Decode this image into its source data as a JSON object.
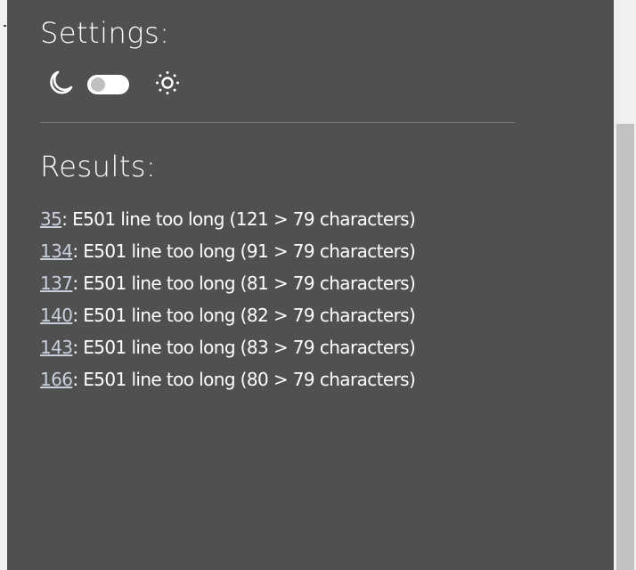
{
  "settings": {
    "title": "Settings:",
    "theme_toggle_on": false
  },
  "results": {
    "title": "Results:",
    "items": [
      {
        "line": "35",
        "message": ": E501 line too long (121 > 79 characters)"
      },
      {
        "line": "134",
        "message": ": E501 line too long (91 > 79 characters)"
      },
      {
        "line": "137",
        "message": ": E501 line too long (81 > 79 characters)"
      },
      {
        "line": "140",
        "message": ": E501 line too long (82 > 79 characters)"
      },
      {
        "line": "143",
        "message": ": E501 line too long (83 > 79 characters)"
      },
      {
        "line": "166",
        "message": ": E501 line too long (80 > 79 characters)"
      }
    ]
  },
  "colors": {
    "panel": "#505050",
    "link": "#c9cfdc",
    "background": "#f0f0f0"
  }
}
